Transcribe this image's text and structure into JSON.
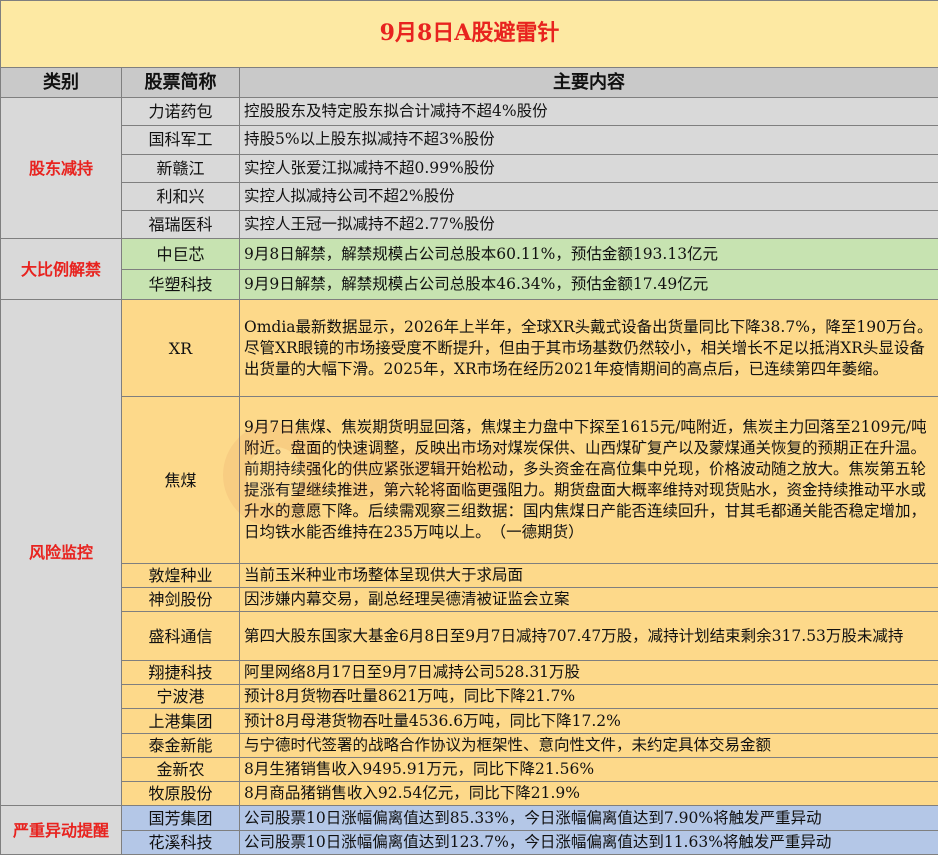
{
  "title": "9月8日A股避雷针",
  "headers": {
    "category": "类别",
    "stock": "股票简称",
    "content": "主要内容"
  },
  "categories": {
    "shareholder_reduce": "股东减持",
    "large_unlock": "大比例解禁",
    "risk_monitor": "风险监控",
    "abnormal_alert": "严重异动提醒"
  },
  "rows": [
    {
      "name": "力诺药包",
      "content": "控股股东及特定股东拟合计减持不超4%股份"
    },
    {
      "name": "国科军工",
      "content": "持股5%以上股东拟减持不超3%股份"
    },
    {
      "name": "新赣江",
      "content": "实控人张爱江拟减持不超0.99%股份"
    },
    {
      "name": "利和兴",
      "content": "实控人拟减持公司不超2%股份"
    },
    {
      "name": "福瑞医科",
      "content": "实控人王冠一拟减持不超2.77%股份"
    },
    {
      "name": "中巨芯",
      "content": "9月8日解禁，解禁规模占公司总股本60.11%，预估金额193.13亿元"
    },
    {
      "name": "华塑科技",
      "content": "9月9日解禁，解禁规模占公司总股本46.34%，预估金额17.49亿元"
    },
    {
      "name": "XR",
      "content": "Omdia最新数据显示，2026年上半年，全球XR头戴式设备出货量同比下降38.7%，降至190万台。尽管XR眼镜的市场接受度不断提升，但由于其市场基数仍然较小，相关增长不足以抵消XR头显设备出货量的大幅下滑。2025年，XR市场在经历2021年疫情期间的高点后，已连续第四年萎缩。"
    },
    {
      "name": "焦煤",
      "content": "9月7日焦煤、焦炭期货明显回落，焦煤主力盘中下探至1615元/吨附近，焦炭主力回落至2109元/吨附近。盘面的快速调整，反映出市场对煤炭保供、山西煤矿复产以及蒙煤通关恢复的预期正在升温。前期持续强化的供应紧张逻辑开始松动，多头资金在高位集中兑现，价格波动随之放大。焦炭第五轮提涨有望继续推进，第六轮将面临更强阻力。期货盘面大概率维持对现货贴水，资金持续推动平水或升水的意愿下降。后续需观察三组数据：国内焦煤日产能否连续回升，甘其毛都通关能否稳定增加，日均铁水能否维持在235万吨以上。　（一德期货）"
    },
    {
      "name": "敦煌种业",
      "content": "当前玉米种业市场整体呈现供大于求局面"
    },
    {
      "name": "神剑股份",
      "content": "因涉嫌内幕交易，副总经理吴德清被证监会立案"
    },
    {
      "name": "盛科通信",
      "content": "第四大股东国家大基金6月8日至9月7日减持707.47万股，减持计划结束剩余317.53万股未减持"
    },
    {
      "name": "翔捷科技",
      "content": "阿里网络8月17日至9月7日减持公司528.31万股"
    },
    {
      "name": "宁波港",
      "content": "预计8月货物吞吐量8621万吨，同比下降21.7%"
    },
    {
      "name": "上港集团",
      "content": "预计8月母港货物吞吐量4536.6万吨，同比下降17.2%"
    },
    {
      "name": "泰金新能",
      "content": "与宁德时代签署的战略合作协议为框架性、意向性文件，未约定具体交易金额"
    },
    {
      "name": "金新农",
      "content": "8月生猪销售收入9495.91万元，同比下降21.56%"
    },
    {
      "name": "牧原股份",
      "content": "8月商品猪销售收入92.54亿元，同比下降21.9%"
    },
    {
      "name": "国芳集团",
      "content": "公司股票10日涨幅偏离值达到85.33%，今日涨幅偏离值达到7.90%将触发严重异动"
    },
    {
      "name": "花溪科技",
      "content": "公司股票10日涨幅偏离值达到123.7%，今日涨幅偏离值达到11.63%将触发严重异动"
    }
  ],
  "colors": {
    "title_bg": "#fde9a3",
    "title_text": "#e8231f",
    "header_bg": "#c9c9c9",
    "category_text": "#e8231f",
    "gray_row": "#d9d9d9",
    "green_row": "#c7e3b1",
    "yellow_row": "#fdd98a",
    "blue_row": "#b4c7e7"
  }
}
